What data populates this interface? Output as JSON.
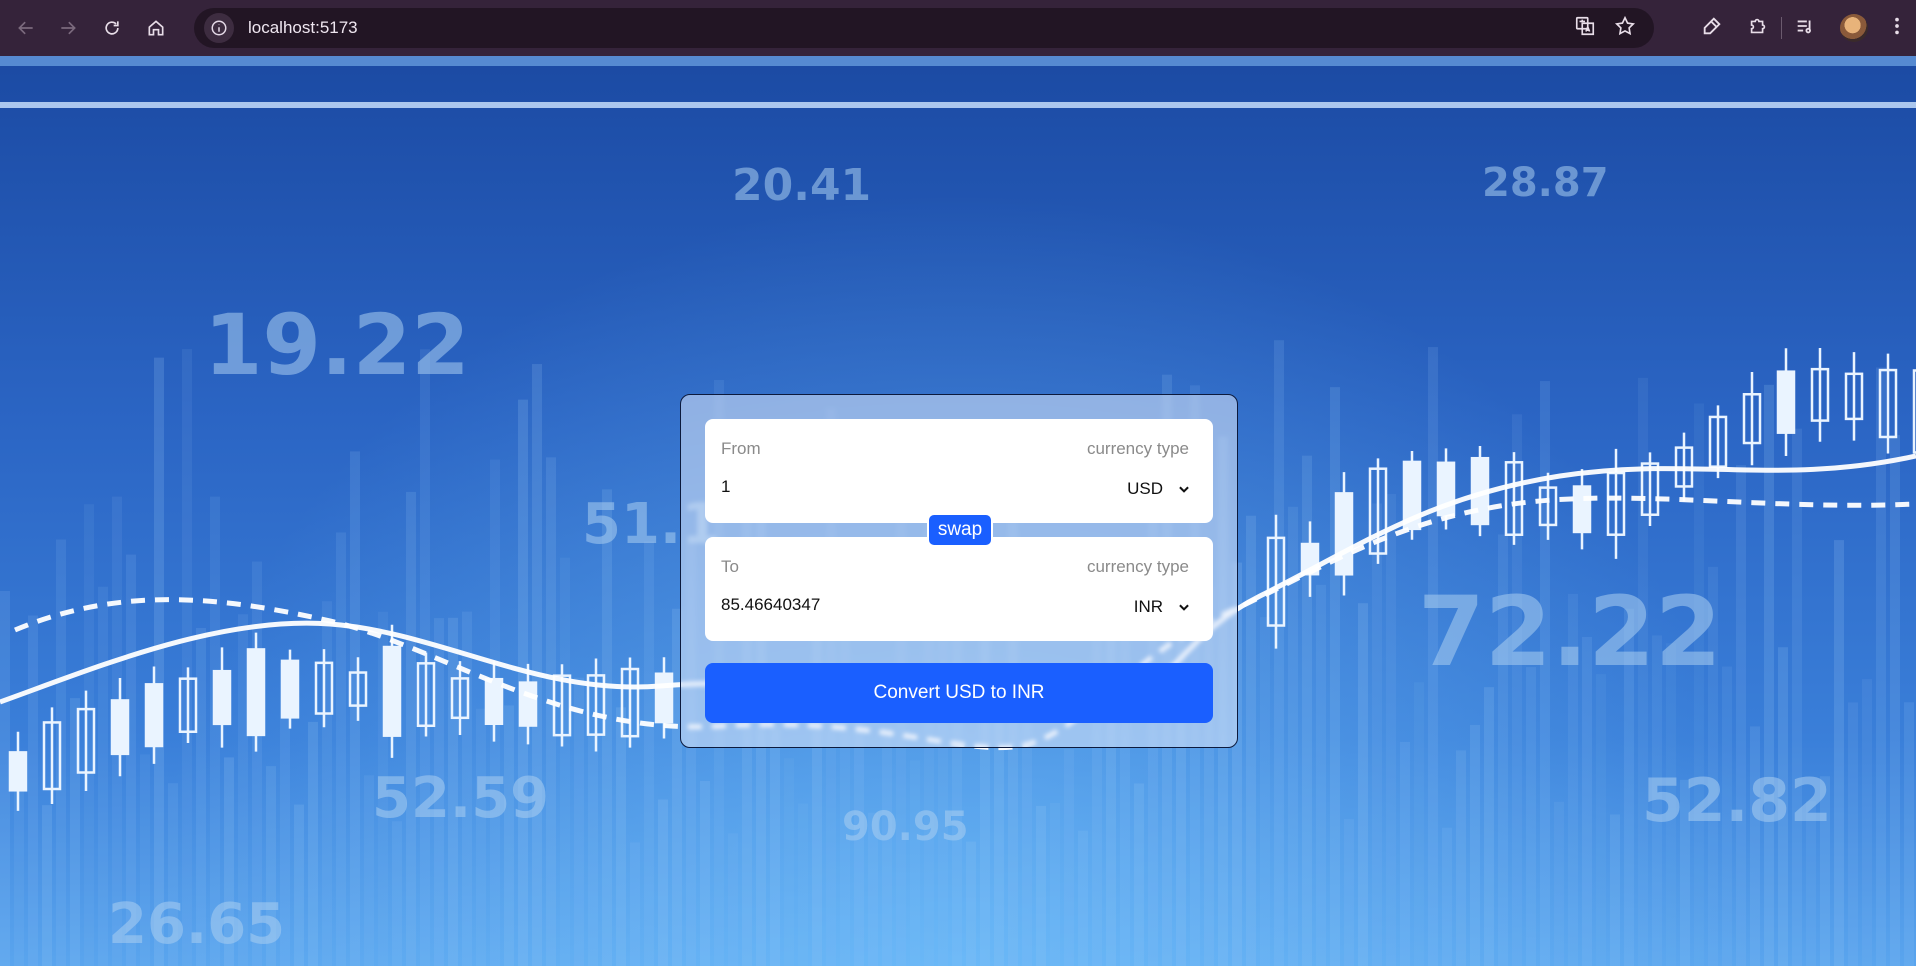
{
  "browser": {
    "url": "localhost:5173"
  },
  "background": {
    "numbers": [
      "20.41",
      "28.87",
      "19.22",
      "51.1",
      "72.22",
      "52.59",
      "90.95",
      "52.82",
      "26.65"
    ]
  },
  "converter": {
    "from": {
      "label": "From",
      "currency_type_label": "currency type",
      "amount": "1",
      "currency": "USD"
    },
    "swap_label": "swap",
    "to": {
      "label": "To",
      "currency_type_label": "currency type",
      "amount": "85.46640347",
      "currency": "INR"
    },
    "convert_label": "Convert USD to INR"
  },
  "colors": {
    "accent": "#1a5fff",
    "chrome": "#35233a"
  }
}
